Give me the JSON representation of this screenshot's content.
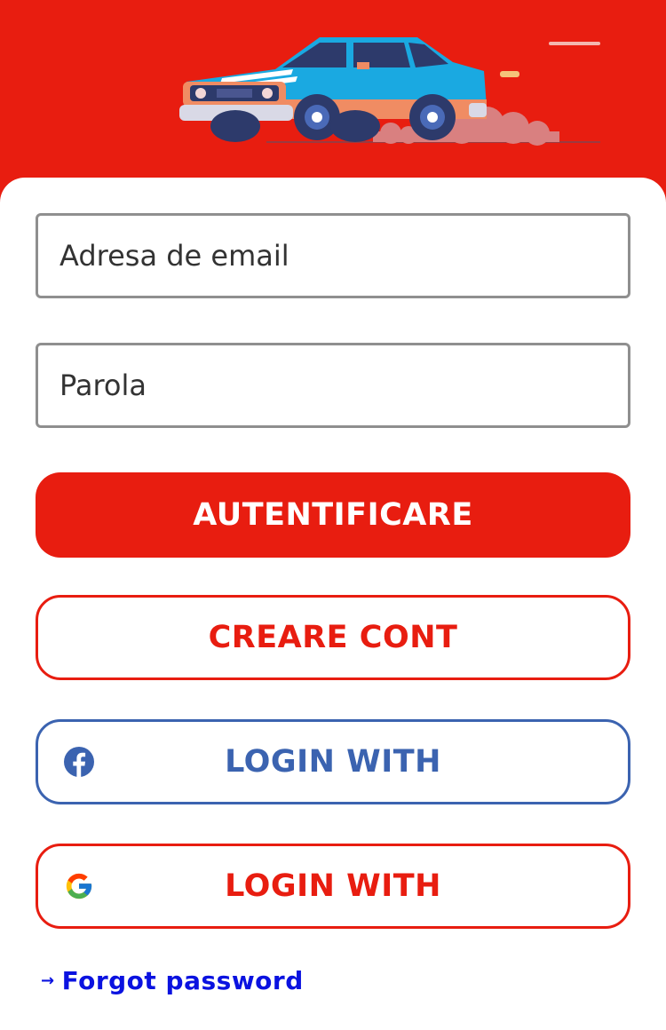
{
  "colors": {
    "primary_red": "#e81d10",
    "facebook_blue": "#3b63b0",
    "link_blue": "#0a12e0",
    "field_border": "#8f8f8f"
  },
  "header": {
    "illustration": "car-illustration"
  },
  "form": {
    "email_placeholder": "Adresa de email",
    "password_placeholder": "Parola"
  },
  "buttons": {
    "login": "AUTENTIFICARE",
    "create_account": "CREARE CONT",
    "facebook_login": "LOGIN WITH",
    "google_login": "LOGIN WITH"
  },
  "icons": {
    "facebook": "facebook-icon",
    "google": "google-icon",
    "arrow": "arrow-right-icon"
  },
  "links": {
    "forgot_password": "Forgot password"
  }
}
